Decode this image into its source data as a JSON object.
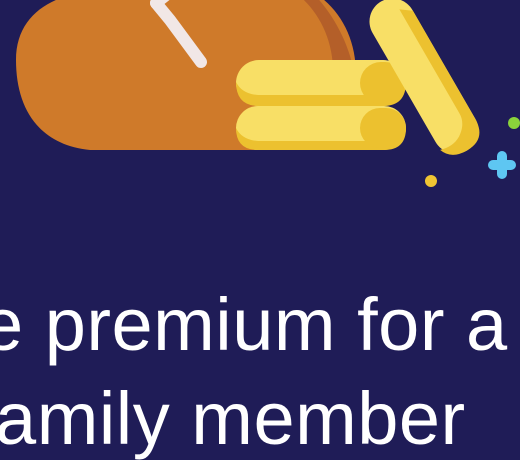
{
  "screen": {
    "background_color": "#1f1c57"
  },
  "illustration": {
    "icons": [
      "piggy-bank-icon",
      "coin-stack-icon",
      "sparkle-icon"
    ],
    "colors": {
      "piggy_body": "#cf7a2a",
      "piggy_shadow": "#b45f29",
      "coin_main": "#f8df66",
      "coin_shadow": "#ecc12f",
      "clock_hand": "#f1e7e6",
      "sparkle_blue": "#5ec6f2",
      "sparkle_green": "#8ad33b",
      "sparkle_gold": "#f0c533"
    }
  },
  "headline": {
    "line_1": "e premium for a",
    "line_2": "family member"
  }
}
